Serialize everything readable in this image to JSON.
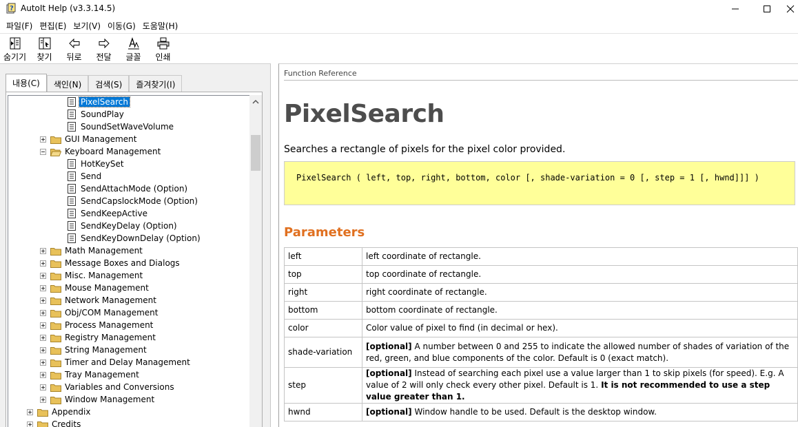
{
  "window": {
    "title": "AutoIt Help (v3.3.14.5)"
  },
  "menu": [
    {
      "label": "파일(F)"
    },
    {
      "label": "편집(E)"
    },
    {
      "label": "보기(V)"
    },
    {
      "label": "이동(G)"
    },
    {
      "label": "도움말(H)"
    }
  ],
  "toolbar": [
    {
      "label": "숨기기",
      "icon": "hide-icon"
    },
    {
      "label": "찾기",
      "icon": "locate-icon"
    },
    {
      "label": "뒤로",
      "icon": "back-arrow-icon"
    },
    {
      "label": "전달",
      "icon": "forward-arrow-icon"
    },
    {
      "label": "글꼴",
      "icon": "font-icon"
    },
    {
      "label": "인쇄",
      "icon": "printer-icon"
    }
  ],
  "tabs": [
    {
      "label": "내용(C)",
      "active": true
    },
    {
      "label": "색인(N)",
      "active": false
    },
    {
      "label": "검색(S)",
      "active": false
    },
    {
      "label": "즐겨찾기(I)",
      "active": false
    }
  ],
  "tree": [
    {
      "label": "PixelSearch",
      "type": "page",
      "level": 2,
      "selected": true
    },
    {
      "label": "SoundPlay",
      "type": "page",
      "level": 2
    },
    {
      "label": "SoundSetWaveVolume",
      "type": "page",
      "level": 2
    },
    {
      "label": "GUI Management",
      "type": "folder",
      "level": 1,
      "expanded": false
    },
    {
      "label": "Keyboard Management",
      "type": "folder",
      "level": 1,
      "expanded": true
    },
    {
      "label": "HotKeySet",
      "type": "page",
      "level": 2
    },
    {
      "label": "Send",
      "type": "page",
      "level": 2
    },
    {
      "label": "SendAttachMode (Option)",
      "type": "page",
      "level": 2
    },
    {
      "label": "SendCapslockMode (Option)",
      "type": "page",
      "level": 2
    },
    {
      "label": "SendKeepActive",
      "type": "page",
      "level": 2
    },
    {
      "label": "SendKeyDelay (Option)",
      "type": "page",
      "level": 2
    },
    {
      "label": "SendKeyDownDelay (Option)",
      "type": "page",
      "level": 2
    },
    {
      "label": "Math Management",
      "type": "folder",
      "level": 1,
      "expanded": false
    },
    {
      "label": "Message Boxes and Dialogs",
      "type": "folder",
      "level": 1,
      "expanded": false
    },
    {
      "label": "Misc. Management",
      "type": "folder",
      "level": 1,
      "expanded": false
    },
    {
      "label": "Mouse Management",
      "type": "folder",
      "level": 1,
      "expanded": false
    },
    {
      "label": "Network Management",
      "type": "folder",
      "level": 1,
      "expanded": false
    },
    {
      "label": "Obj/COM Management",
      "type": "folder",
      "level": 1,
      "expanded": false
    },
    {
      "label": "Process Management",
      "type": "folder",
      "level": 1,
      "expanded": false
    },
    {
      "label": "Registry Management",
      "type": "folder",
      "level": 1,
      "expanded": false
    },
    {
      "label": "String Management",
      "type": "folder",
      "level": 1,
      "expanded": false
    },
    {
      "label": "Timer and Delay Management",
      "type": "folder",
      "level": 1,
      "expanded": false
    },
    {
      "label": "Tray Management",
      "type": "folder",
      "level": 1,
      "expanded": false
    },
    {
      "label": "Variables and Conversions",
      "type": "folder",
      "level": 1,
      "expanded": false
    },
    {
      "label": "Window Management",
      "type": "folder",
      "level": 1,
      "expanded": false
    },
    {
      "label": "Appendix",
      "type": "folder",
      "level": 0,
      "expanded": false
    },
    {
      "label": "Credits",
      "type": "folder",
      "level": 0,
      "expanded": false
    }
  ],
  "content": {
    "breadcrumb": "Function Reference",
    "title": "PixelSearch",
    "summary": "Searches a rectangle of pixels for the pixel color provided.",
    "syntax": "PixelSearch ( left, top, right, bottom, color [, shade-variation = 0 [, step = 1 [, hwnd]]] )",
    "parameters_title": "Parameters",
    "parameters": [
      {
        "name": "left",
        "parts": [
          {
            "text": "left coordinate of rectangle."
          }
        ]
      },
      {
        "name": "top",
        "parts": [
          {
            "text": "top coordinate of rectangle."
          }
        ]
      },
      {
        "name": "right",
        "parts": [
          {
            "text": "right coordinate of rectangle."
          }
        ]
      },
      {
        "name": "bottom",
        "parts": [
          {
            "text": "bottom coordinate of rectangle."
          }
        ]
      },
      {
        "name": "color",
        "parts": [
          {
            "text": "Color value of pixel to find (in decimal or hex)."
          }
        ]
      },
      {
        "name": "shade-variation",
        "parts": [
          {
            "text": "[optional]",
            "bold": true
          },
          {
            "text": " A number between 0 and 255 to indicate the allowed number of shades of variation of the red, green, and blue components of the color. Default is 0 (exact match)."
          }
        ]
      },
      {
        "name": "step",
        "parts": [
          {
            "text": "[optional]",
            "bold": true
          },
          {
            "text": " Instead of searching each pixel use a value larger than 1 to skip pixels (for speed). E.g. A value of 2 will only check every other pixel. Default is 1. "
          },
          {
            "text": "It is not recommended to use a step value greater than 1.",
            "bold": true
          }
        ]
      },
      {
        "name": "hwnd",
        "parts": [
          {
            "text": "[optional]",
            "bold": true
          },
          {
            "text": " Window handle to be used. Default is the desktop window."
          }
        ]
      }
    ]
  },
  "colors": {
    "selection": "#0078d7",
    "syntax_bg": "#ffff99",
    "section_title": "#e07020",
    "folder": "#e8c15a"
  }
}
